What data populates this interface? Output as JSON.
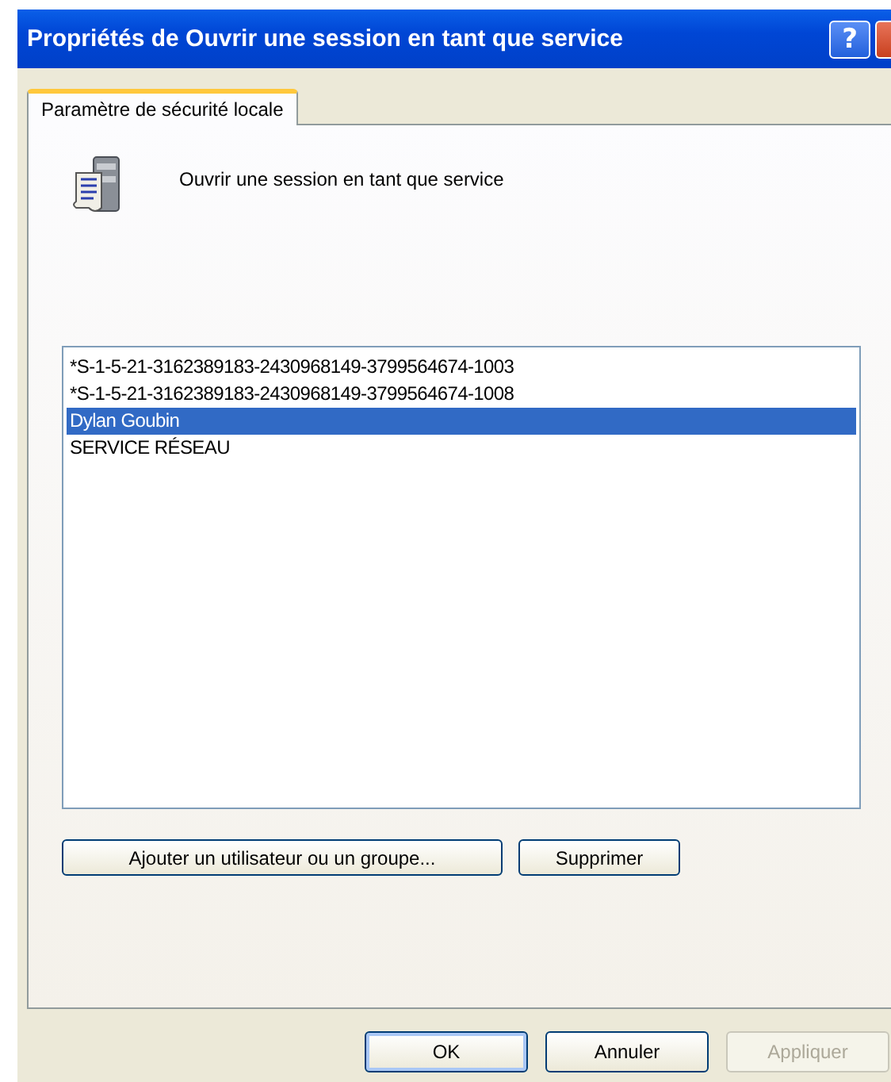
{
  "window": {
    "title": "Propriétés de Ouvrir une session en tant que service",
    "help_button": "?"
  },
  "tabs": [
    {
      "label": "Paramètre de sécurité locale",
      "selected": true
    }
  ],
  "policy": {
    "name": "Ouvrir une session en tant que service"
  },
  "accounts": [
    {
      "name": "*S-1-5-21-3162389183-2430968149-3799564674-1003",
      "selected": false
    },
    {
      "name": "*S-1-5-21-3162389183-2430968149-3799564674-1008",
      "selected": false
    },
    {
      "name": "Dylan Goubin",
      "selected": true
    },
    {
      "name": "SERVICE RÉSEAU",
      "selected": false
    }
  ],
  "list_buttons": [
    {
      "label": "Ajouter un utilisateur ou un groupe...",
      "disabled": false
    },
    {
      "label": "Supprimer",
      "disabled": false
    }
  ],
  "buttons": [
    {
      "label": "OK",
      "default": true,
      "disabled": false
    },
    {
      "label": "Annuler",
      "default": false,
      "disabled": false
    },
    {
      "label": "Appliquer",
      "default": false,
      "disabled": true
    }
  ]
}
